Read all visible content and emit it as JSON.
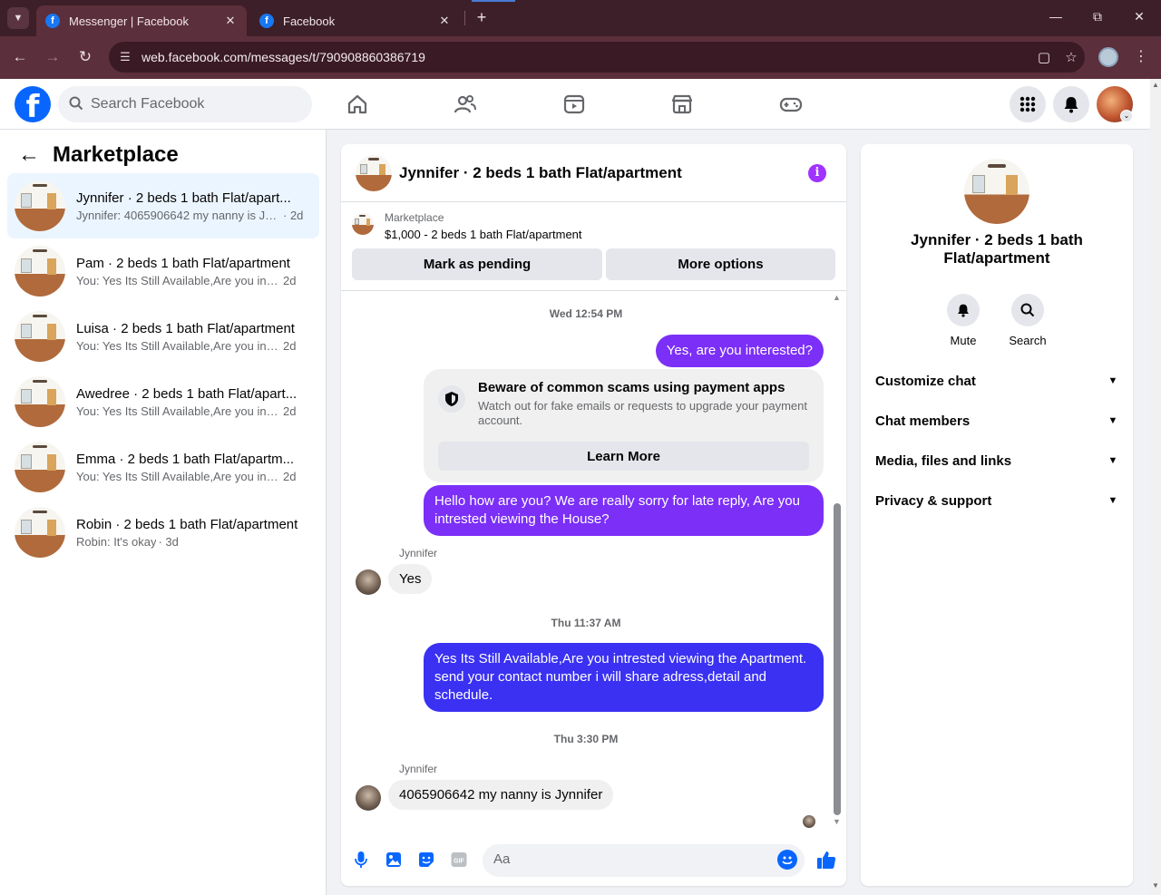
{
  "browser": {
    "tabs": [
      {
        "title": "Messenger | Facebook",
        "active": true
      },
      {
        "title": "Facebook",
        "active": false
      }
    ],
    "url": "web.facebook.com/messages/t/790908860386719",
    "icons": {
      "back": "arrow-left-icon",
      "forward": "arrow-right-icon",
      "reload": "reload-icon",
      "site_info": "tune-icon",
      "install": "install-icon",
      "bookmark": "star-icon",
      "menu": "kebab-icon"
    }
  },
  "fb_header": {
    "search_placeholder": "Search Facebook",
    "nav_icons": [
      "home-icon",
      "friends-icon",
      "video-icon",
      "marketplace-icon",
      "gaming-icon"
    ],
    "right_icons": [
      "menu-grid-icon",
      "bell-icon"
    ]
  },
  "sidebar": {
    "title": "Marketplace",
    "conversations": [
      {
        "name": "Jynnifer · 2 beds 1 bath Flat/apart...",
        "snippet": "Jynnifer: 4065906642 my nanny is Jyn...",
        "age": "· 2d",
        "active": true
      },
      {
        "name": "Pam · 2 beds 1 bath Flat/apartment",
        "snippet": "You: Yes Its Still Available,Are you intre...",
        "age": "2d"
      },
      {
        "name": "Luisa · 2 beds 1 bath Flat/apartment",
        "snippet": "You: Yes Its Still Available,Are you intre...",
        "age": "2d"
      },
      {
        "name": "Awedree · 2 beds 1 bath Flat/apart...",
        "snippet": "You: Yes Its Still Available,Are you intre...",
        "age": "2d"
      },
      {
        "name": "Emma · 2 beds 1 bath Flat/apartm...",
        "snippet": "You: Yes Its Still Available,Are you intre...",
        "age": "2d"
      },
      {
        "name": "Robin · 2 beds 1 bath Flat/apartment",
        "snippet": "Robin: It's okay",
        "age": "· 3d"
      }
    ]
  },
  "chat": {
    "title": "Jynnifer · 2 beds 1 bath Flat/apartment",
    "marketplace_label": "Marketplace",
    "listing": "$1,000 - 2 beds 1 bath Flat/apartment",
    "mark_pending": "Mark as pending",
    "more_options": "More options",
    "stamp1": "Wed 12:54 PM",
    "msg_out1": "Yes, are you interested?",
    "warning": {
      "title": "Beware of common scams using payment apps",
      "body": "Watch out for fake emails or requests to upgrade your payment account.",
      "button": "Learn More"
    },
    "msg_out2": "Hello how are you? We are really sorry for late reply, Are you intrested viewing the House?",
    "sender1": "Jynnifer",
    "msg_in1": "Yes",
    "stamp2": "Thu 11:37 AM",
    "msg_out3": "Yes Its Still Available,Are you intrested viewing the Apartment. send your contact number i will share adress,detail and schedule.",
    "stamp3": "Thu 3:30 PM",
    "sender2": "Jynnifer",
    "msg_in2": "4065906642 my nanny is Jynnifer",
    "composer_placeholder": "Aa",
    "accent_purple": "#7b2ff7",
    "accent_blue": "#3a31f2"
  },
  "info_panel": {
    "name": "Jynnifer · 2 beds 1 bath Flat/apartment",
    "mute": "Mute",
    "search": "Search",
    "sections": [
      "Customize chat",
      "Chat members",
      "Media, files and links",
      "Privacy & support"
    ]
  }
}
